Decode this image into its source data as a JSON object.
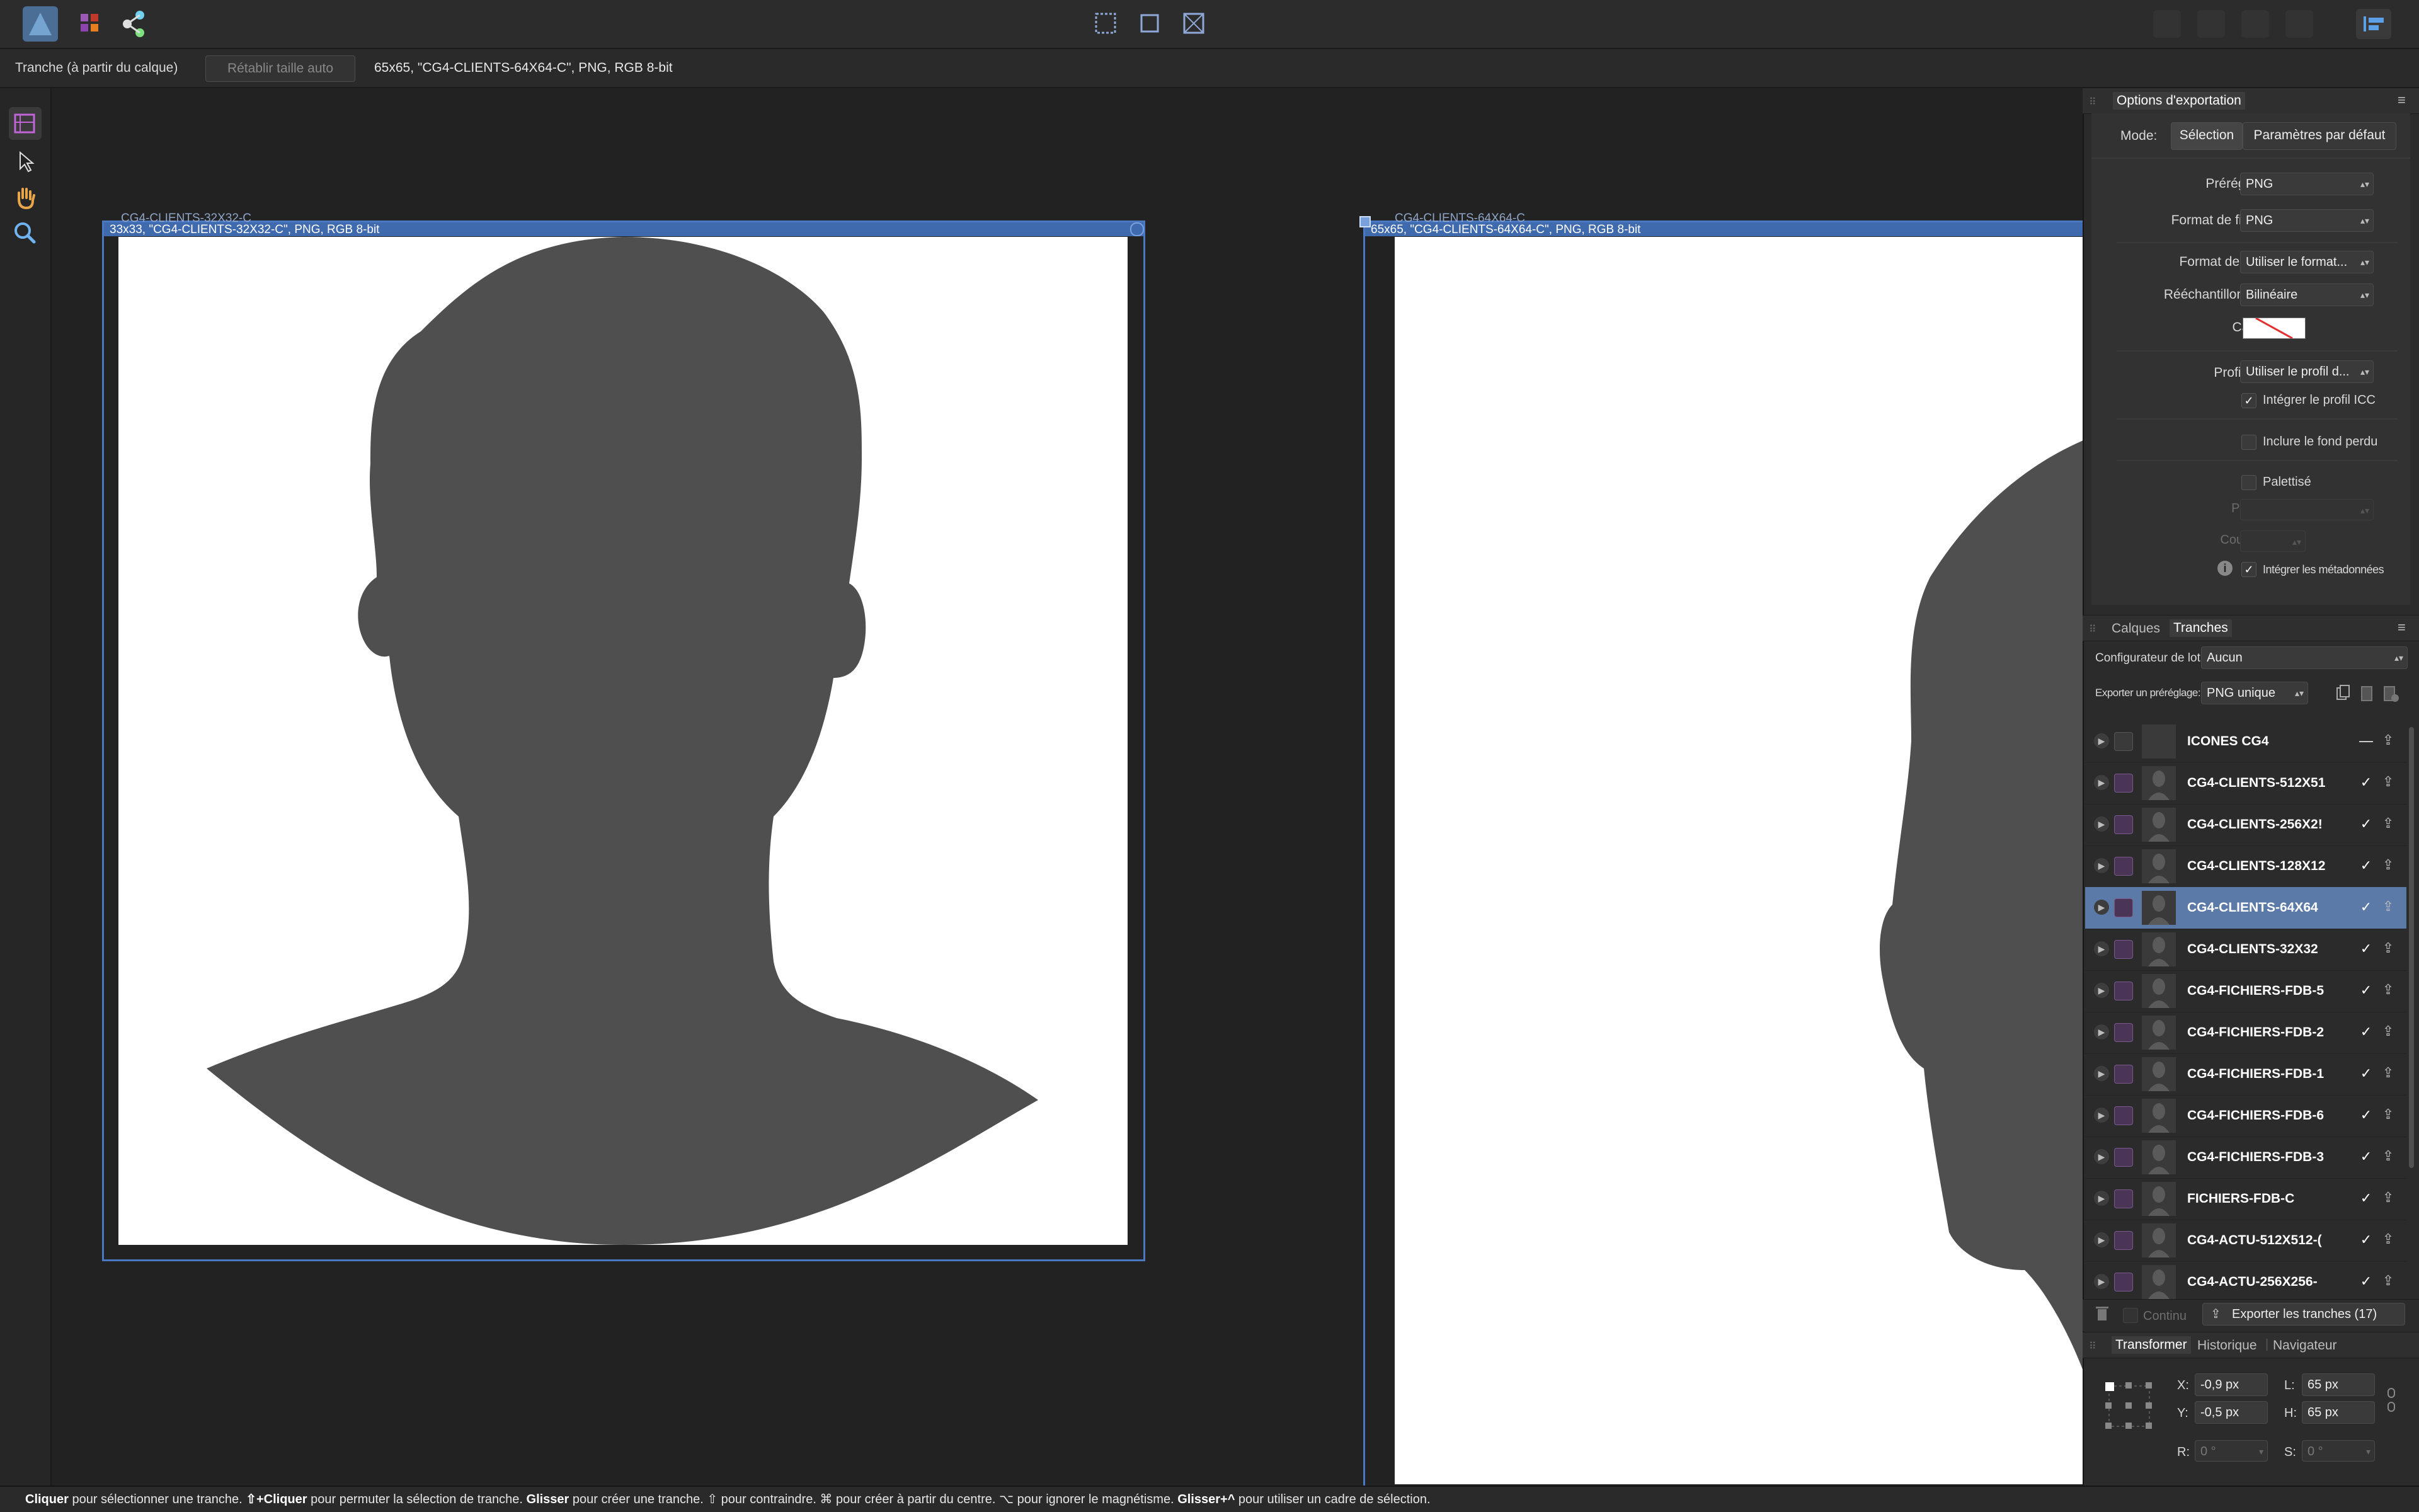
{
  "toolbar": {
    "personas": [
      "designer-persona-icon",
      "pixel-persona-icon",
      "export-persona-icon"
    ],
    "center_tools": [
      "slice-select-icon",
      "slice-fit-icon",
      "slice-grid-icon"
    ]
  },
  "context_bar": {
    "slice_from_layer": "Tranche (à partir du calque)",
    "reset_size_button": "Rétablir taille auto",
    "slice_info": "65x65, \"CG4-CLIENTS-64X64-C\", PNG, RGB 8-bit"
  },
  "canvas": {
    "slice_left_title": "CG4-CLIENTS-32X32-C",
    "slice_left_label": "33x33, \"CG4-CLIENTS-32X32-C\", PNG, RGB 8-bit",
    "slice_right_title": "CG4-CLIENTS-64X64-C",
    "slice_right_label": "65x65, \"CG4-CLIENTS-64X64-C\", PNG, RGB 8-bit",
    "silhouette_color": "#4f4f4f"
  },
  "export_options": {
    "title": "Options d'exportation",
    "mode_label": "Mode:",
    "mode_selection": "Sélection",
    "mode_defaults": "Paramètres par défaut",
    "preset_label": "Préréglage:",
    "preset_value": "PNG",
    "file_format_label": "Format de fichier:",
    "file_format_value": "PNG",
    "pixel_format_label": "Format de pixel:",
    "pixel_format_value": "Utiliser le format...",
    "resampler_label": "Rééchantillonneur:",
    "resampler_value": "Bilinéaire",
    "matte_label": "Cache:",
    "icc_label": "Profil ICC:",
    "icc_value": "Utiliser le profil d...",
    "embed_icc": "Intégrer le profil ICC",
    "include_bleed": "Inclure le fond perdu",
    "palettised": "Palettisé",
    "palette_label": "Palette:",
    "colours_label": "Couleurs:",
    "embed_metadata": "Intégrer les métadonnées"
  },
  "slices_panel": {
    "tab_layers": "Calques",
    "tab_slices": "Tranches",
    "batch_label": "Configurateur de lot:",
    "batch_value": "Aucun",
    "export_preset_label": "Exporter un préréglage:",
    "export_preset_value": "PNG unique",
    "items": [
      {
        "name": "ICONES CG4",
        "checked": false,
        "selected": false
      },
      {
        "name": "CG4-CLIENTS-512X51",
        "checked": true,
        "selected": false
      },
      {
        "name": "CG4-CLIENTS-256X2!",
        "checked": true,
        "selected": false
      },
      {
        "name": "CG4-CLIENTS-128X12",
        "checked": true,
        "selected": false
      },
      {
        "name": "CG4-CLIENTS-64X64",
        "checked": true,
        "selected": true
      },
      {
        "name": "CG4-CLIENTS-32X32",
        "checked": true,
        "selected": false
      },
      {
        "name": "CG4-FICHIERS-FDB-5",
        "checked": true,
        "selected": false
      },
      {
        "name": "CG4-FICHIERS-FDB-2",
        "checked": true,
        "selected": false
      },
      {
        "name": "CG4-FICHIERS-FDB-1",
        "checked": true,
        "selected": false
      },
      {
        "name": "CG4-FICHIERS-FDB-6",
        "checked": true,
        "selected": false
      },
      {
        "name": "CG4-FICHIERS-FDB-3",
        "checked": true,
        "selected": false
      },
      {
        "name": "FICHIERS-FDB-C",
        "checked": true,
        "selected": false
      },
      {
        "name": "CG4-ACTU-512X512-(",
        "checked": true,
        "selected": false
      },
      {
        "name": "CG4-ACTU-256X256-",
        "checked": true,
        "selected": false
      }
    ],
    "continuous_label": "Continu",
    "export_slices_button": "Exporter les tranches (17)"
  },
  "transform_panel": {
    "tab_transform": "Transformer",
    "tab_history": "Historique",
    "tab_navigator": "Navigateur",
    "x_label": "X:",
    "x_value": "-0,9 px",
    "y_label": "Y:",
    "y_value": "-0,5 px",
    "w_label": "L:",
    "w_value": "65 px",
    "h_label": "H:",
    "h_value": "65 px",
    "r_label": "R:",
    "r_value": "0 °",
    "s_label": "S:",
    "s_value": "0 °"
  },
  "status": {
    "k1": "Cliquer",
    "t1": " pour sélectionner une tranche. ",
    "k2": "⇧+Cliquer",
    "t2": " pour permuter la sélection de tranche. ",
    "k3": "Glisser",
    "t3": " pour créer une tranche. ⇧ pour contraindre. ⌘ pour créer à partir du centre. ⌥ pour ignorer le magnétisme. ",
    "k4": "Glisser+^",
    "t4": " pour utiliser un cadre de sélection."
  }
}
